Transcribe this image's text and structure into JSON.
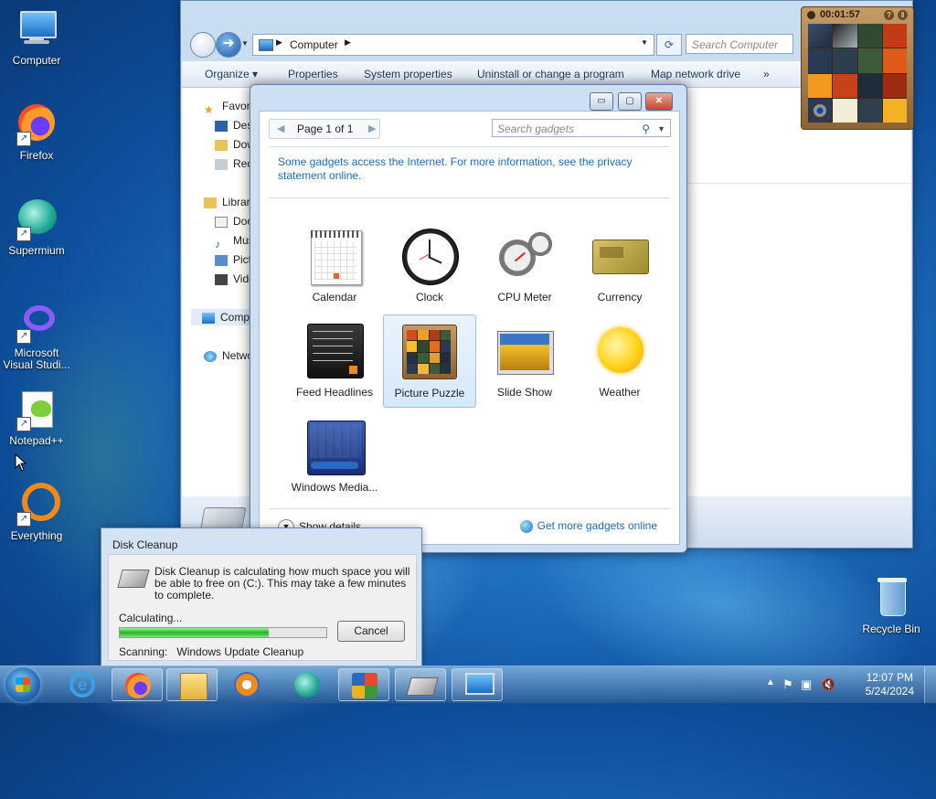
{
  "desktop": {
    "icons": [
      {
        "label": "Computer"
      },
      {
        "label": "Firefox"
      },
      {
        "label": "Supermium"
      },
      {
        "label": "Microsoft Visual Studi..."
      },
      {
        "label": "Notepad++"
      },
      {
        "label": "Everything"
      },
      {
        "label": "Recycle Bin"
      }
    ]
  },
  "explorer": {
    "address": "Computer",
    "search_placeholder": "Search Computer",
    "commands": [
      "Organize",
      "Properties",
      "System properties",
      "Uninstall or change a program",
      "Map network drive",
      "»"
    ],
    "nav": {
      "favorites": "Favorites",
      "fav_items": [
        "Desktop",
        "Downloads",
        "Recent Places"
      ],
      "libraries": "Libraries",
      "lib_items": [
        "Documents",
        "Music",
        "Pictures",
        "Videos"
      ],
      "computer": "Computer",
      "network": "Network"
    }
  },
  "gallery": {
    "page_label": "Page 1 of 1",
    "search_placeholder": "Search gadgets",
    "notice": "Some gadgets access the Internet.  For more information, see the privacy statement online.",
    "gadgets": [
      {
        "label": "Calendar"
      },
      {
        "label": "Clock"
      },
      {
        "label": "CPU Meter"
      },
      {
        "label": "Currency"
      },
      {
        "label": "Feed Headlines"
      },
      {
        "label": "Picture Puzzle"
      },
      {
        "label": "Slide Show"
      },
      {
        "label": "Weather"
      },
      {
        "label": "Windows Media..."
      }
    ],
    "show_details": "Show details",
    "get_more": "Get more gadgets online"
  },
  "puzzle": {
    "timer": "00:01:57"
  },
  "disk_cleanup": {
    "title": "Disk Cleanup",
    "message": "Disk Cleanup is calculating how much space you will be able to free on  (C:). This may take a few minutes to complete.",
    "calculating": "Calculating...",
    "progress": 0.72,
    "cancel": "Cancel",
    "scanning": "Scanning:   Windows Update Cleanup"
  },
  "taskbar": {
    "time": "12:07 PM",
    "date": "5/24/2024"
  }
}
